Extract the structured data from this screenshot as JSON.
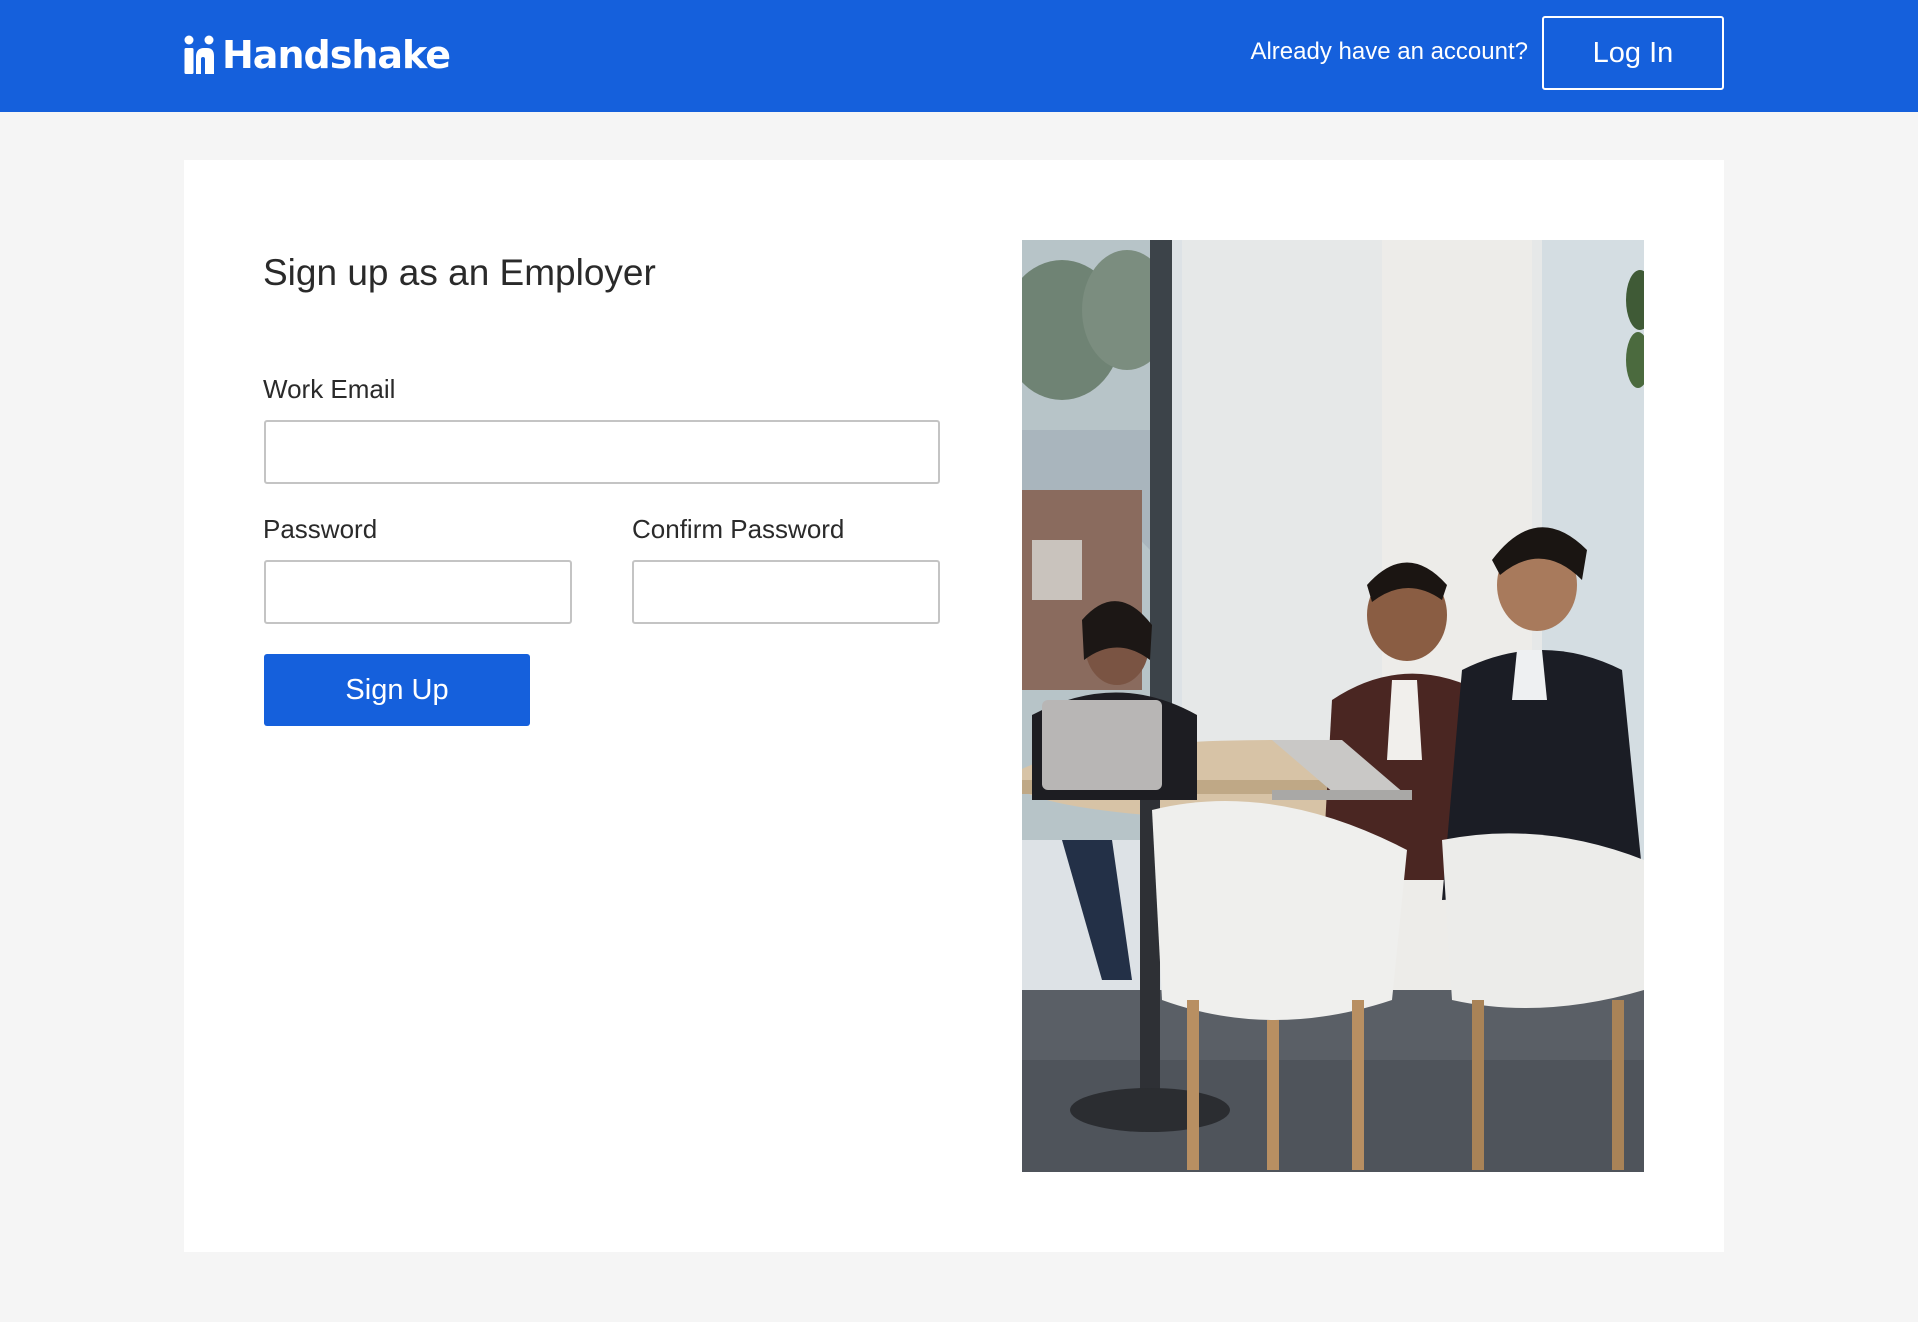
{
  "header": {
    "brand": "Handshake",
    "logo_icon": "handshake-logo-icon",
    "account_prompt": "Already have an account?",
    "login_label": "Log In",
    "background_color": "#1560dc"
  },
  "form": {
    "title": "Sign up as an Employer",
    "email_label": "Work Email",
    "email_value": "",
    "password_label": "Password",
    "password_value": "",
    "confirm_label": "Confirm Password",
    "confirm_value": "",
    "submit_label": "Sign Up",
    "accent_color": "#1560dc"
  },
  "hero_image": {
    "description_icon": "meeting-photo"
  }
}
